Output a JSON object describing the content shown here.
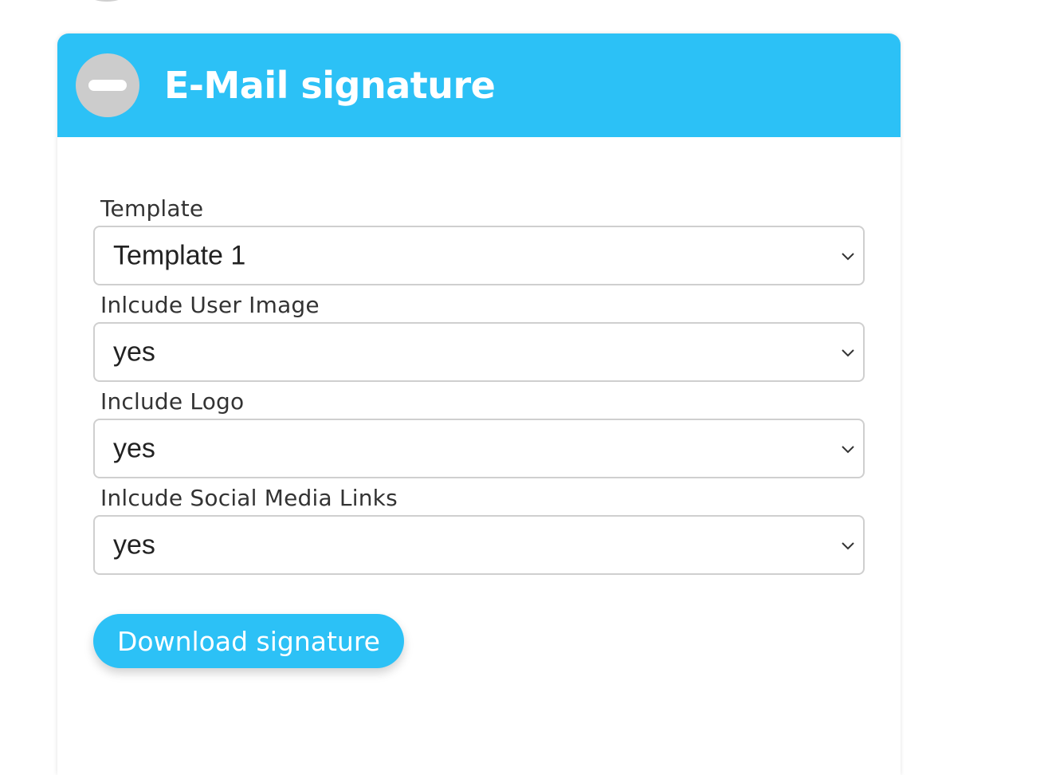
{
  "panel": {
    "title": "E-Mail signature",
    "collapse_icon": "minus-circle-icon",
    "accent_color": "#2cc1f6"
  },
  "fields": [
    {
      "label": "Template",
      "value": "Template 1"
    },
    {
      "label": "Inlcude User Image",
      "value": "yes"
    },
    {
      "label": "Include Logo",
      "value": "yes"
    },
    {
      "label": "Inlcude Social Media Links",
      "value": "yes"
    }
  ],
  "download_button": {
    "label": "Download signature"
  }
}
